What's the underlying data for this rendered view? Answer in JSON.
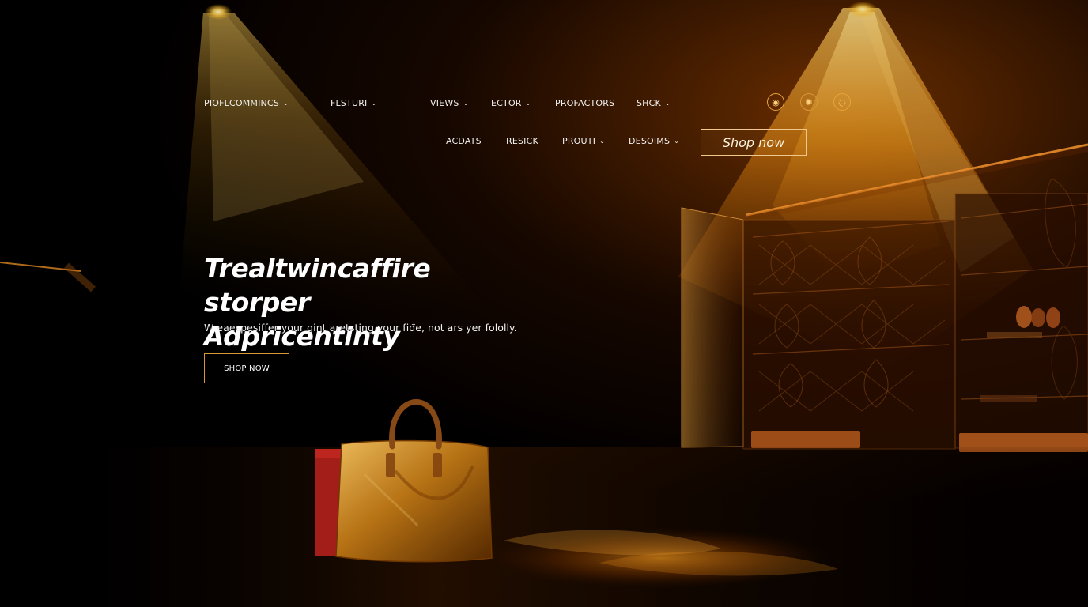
{
  "nav": {
    "row1": [
      {
        "label": "PIOFLCOMMINCS",
        "dropdown": true
      },
      {
        "label": "FLSTURI",
        "dropdown": true
      },
      {
        "label": "VIEWS",
        "dropdown": true
      },
      {
        "label": "ECTOR",
        "dropdown": true
      },
      {
        "label": "PROFACTORS",
        "dropdown": false
      },
      {
        "label": "SHCK",
        "dropdown": true
      }
    ],
    "row2": [
      {
        "label": "ACDATS",
        "dropdown": false
      },
      {
        "label": "RESICK",
        "dropdown": false
      },
      {
        "label": "PROUTI",
        "dropdown": true
      },
      {
        "label": "DESOIMS",
        "dropdown": true
      }
    ],
    "chevron": "⌄",
    "icons": [
      {
        "name": "user-icon",
        "glyph": "◉"
      },
      {
        "name": "settings-icon",
        "glyph": "✺"
      },
      {
        "name": "cart-icon",
        "glyph": "◌"
      }
    ],
    "shop_button": "Shop now"
  },
  "hero": {
    "title_line1": "Trealtwincaffire storper",
    "title_line2": "Adpricentinty",
    "subtitle": "W eaespesiffer your gint aretsting your fiđe, not ars yer fololly.",
    "cta": "SHOP NOW"
  },
  "colors": {
    "background": "#000000",
    "accent": "#d89636",
    "warm_light": "#ffb347"
  }
}
